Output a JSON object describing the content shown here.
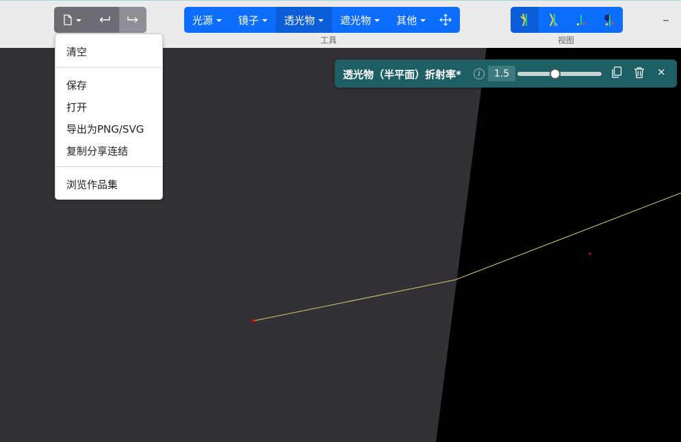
{
  "file_menu": {
    "items": [
      "清空",
      "保存",
      "打开",
      "导出为PNG/SVG",
      "复制分享连结",
      "浏览作品集"
    ]
  },
  "tools": {
    "label": "工具",
    "items": [
      {
        "label": "光源"
      },
      {
        "label": "镜子"
      },
      {
        "label": "透光物"
      },
      {
        "label": "遮光物"
      },
      {
        "label": "其他"
      }
    ]
  },
  "view": {
    "label": "视图"
  },
  "object_bar": {
    "title": "透光物（半平面）折射率*",
    "refractive_index_value": "1.5",
    "slider_fraction": 0.45
  },
  "colors": {
    "toolbar_bg": "#ebebeb",
    "primary": "#0d6efd",
    "primary_active": "#0b5ed7",
    "object_bar_bg": "#1e5f66",
    "ray": "#d8d070",
    "canvas_left": "#333036",
    "canvas_right": "#000000",
    "point_marker": "#ff0000"
  },
  "icons": [
    "file-icon",
    "undo-icon",
    "redo-icon",
    "move-icon",
    "view-rays-icon",
    "view-extended-rays-icon",
    "view-all-images-icon",
    "view-observer-icon",
    "info-icon",
    "duplicate-icon",
    "trash-icon",
    "close-icon",
    "minimize-icon"
  ]
}
